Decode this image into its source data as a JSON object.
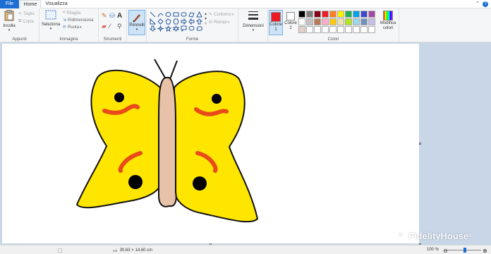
{
  "tabs": {
    "file": "File",
    "home": "Home",
    "view": "Visualizza"
  },
  "groups": {
    "clipboard": {
      "label": "Appunti",
      "paste": "Incolla",
      "cut": "Taglia",
      "copy": "Copia"
    },
    "image": {
      "label": "Immagine",
      "select": "Seleziona",
      "crop": "Ritaglia",
      "resize": "Ridimensiona",
      "rotate": "Ruota"
    },
    "tools": {
      "label": "Strumenti"
    },
    "brushes": {
      "label": "Pennelli"
    },
    "shapes": {
      "label": "Forme",
      "outline": "Contorno",
      "fill": "Riempi"
    },
    "size": {
      "label": "Dimensioni"
    },
    "colors": {
      "label": "Colori",
      "color1": "Colore 1",
      "color2": "Colore 2",
      "edit": "Modifica colori"
    }
  },
  "colors": {
    "color1": "#ed1c24",
    "color2": "#ffffff",
    "palette": [
      "#000000",
      "#7f7f7f",
      "#880015",
      "#ed1c24",
      "#ff7f27",
      "#fff200",
      "#22b14c",
      "#00a2e8",
      "#3f48cc",
      "#a349a4",
      "#ffffff",
      "#c3c3c3",
      "#b97a57",
      "#ffaec9",
      "#ffc90e",
      "#efe4b0",
      "#b5e61d",
      "#99d9ea",
      "#7092be",
      "#c8bfe7",
      "#e0d0c8",
      "#ffffff",
      "#ffffff",
      "#ffffff",
      "#ffffff",
      "#ffffff",
      "#ffffff",
      "#ffffff",
      "#ffffff",
      "#ffffff"
    ]
  },
  "status": {
    "canvas_size": "30,63 × 14,60  cm",
    "zoom": "100 %",
    "zoom_fraction": 0.55
  },
  "watermark": {
    "text": "FidelityHouse",
    "mark": "®"
  }
}
